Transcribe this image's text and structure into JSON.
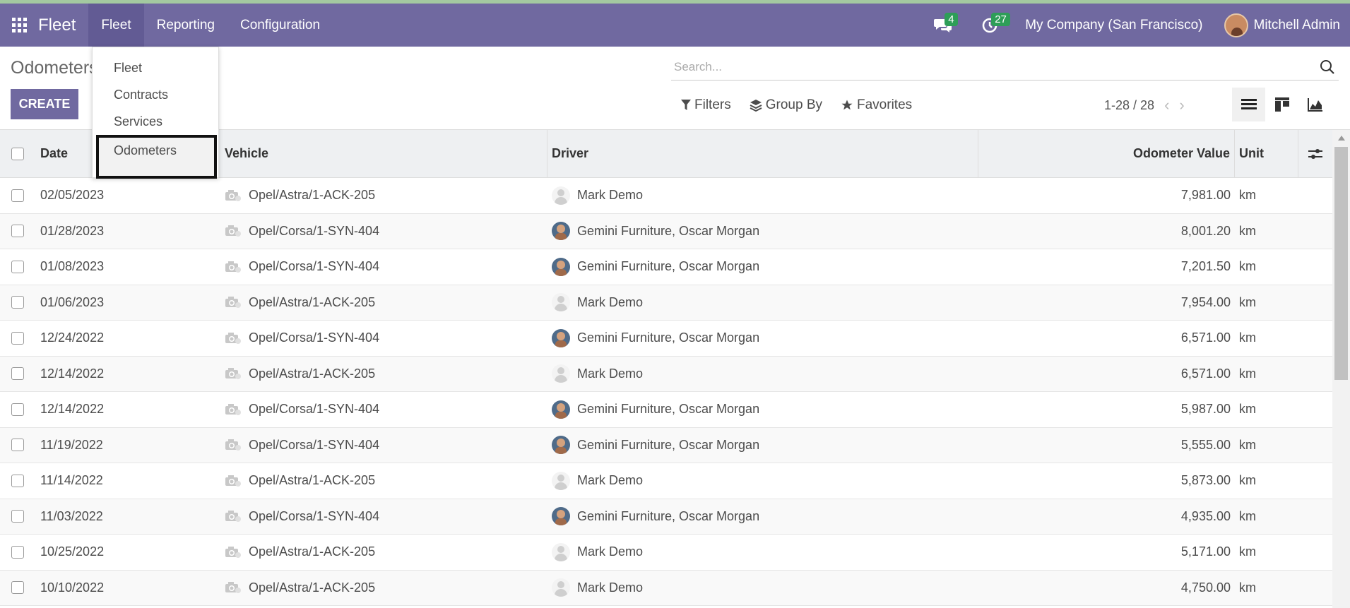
{
  "navbar": {
    "brand": "Fleet",
    "menu": [
      "Fleet",
      "Reporting",
      "Configuration"
    ],
    "messages_count": "4",
    "activities_count": "27",
    "company": "My Company (San Francisco)",
    "user": "Mitchell Admin",
    "accent": "#7069a0"
  },
  "page": {
    "title": "Odometers",
    "create_label": "CREATE"
  },
  "search": {
    "placeholder": "Search...",
    "filters": "Filters",
    "group_by": "Group By",
    "favorites": "Favorites"
  },
  "pager": {
    "range": "1-28 / 28"
  },
  "dropdown": {
    "items": [
      "Fleet",
      "Contracts",
      "Services",
      "Odometers"
    ]
  },
  "table": {
    "headers": {
      "date": "Date",
      "vehicle": "Vehicle",
      "driver": "Driver",
      "value": "Odometer Value",
      "unit": "Unit"
    },
    "rows": [
      {
        "date": "02/05/2023",
        "vehicle": "Opel/Astra/1-ACK-205",
        "driver": "Mark Demo",
        "avatar": "blank",
        "value": "7,981.00",
        "unit": "km"
      },
      {
        "date": "01/28/2023",
        "vehicle": "Opel/Corsa/1-SYN-404",
        "driver": "Gemini Furniture, Oscar Morgan",
        "avatar": "photo",
        "value": "8,001.20",
        "unit": "km"
      },
      {
        "date": "01/08/2023",
        "vehicle": "Opel/Corsa/1-SYN-404",
        "driver": "Gemini Furniture, Oscar Morgan",
        "avatar": "photo",
        "value": "7,201.50",
        "unit": "km"
      },
      {
        "date": "01/06/2023",
        "vehicle": "Opel/Astra/1-ACK-205",
        "driver": "Mark Demo",
        "avatar": "blank",
        "value": "7,954.00",
        "unit": "km"
      },
      {
        "date": "12/24/2022",
        "vehicle": "Opel/Corsa/1-SYN-404",
        "driver": "Gemini Furniture, Oscar Morgan",
        "avatar": "photo",
        "value": "6,571.00",
        "unit": "km"
      },
      {
        "date": "12/14/2022",
        "vehicle": "Opel/Astra/1-ACK-205",
        "driver": "Mark Demo",
        "avatar": "blank",
        "value": "6,571.00",
        "unit": "km"
      },
      {
        "date": "12/14/2022",
        "vehicle": "Opel/Corsa/1-SYN-404",
        "driver": "Gemini Furniture, Oscar Morgan",
        "avatar": "photo",
        "value": "5,987.00",
        "unit": "km"
      },
      {
        "date": "11/19/2022",
        "vehicle": "Opel/Corsa/1-SYN-404",
        "driver": "Gemini Furniture, Oscar Morgan",
        "avatar": "photo",
        "value": "5,555.00",
        "unit": "km"
      },
      {
        "date": "11/14/2022",
        "vehicle": "Opel/Astra/1-ACK-205",
        "driver": "Mark Demo",
        "avatar": "blank",
        "value": "5,873.00",
        "unit": "km"
      },
      {
        "date": "11/03/2022",
        "vehicle": "Opel/Corsa/1-SYN-404",
        "driver": "Gemini Furniture, Oscar Morgan",
        "avatar": "photo",
        "value": "4,935.00",
        "unit": "km"
      },
      {
        "date": "10/25/2022",
        "vehicle": "Opel/Astra/1-ACK-205",
        "driver": "Mark Demo",
        "avatar": "blank",
        "value": "5,171.00",
        "unit": "km"
      },
      {
        "date": "10/10/2022",
        "vehicle": "Opel/Astra/1-ACK-205",
        "driver": "Mark Demo",
        "avatar": "blank",
        "value": "4,750.00",
        "unit": "km"
      }
    ]
  }
}
